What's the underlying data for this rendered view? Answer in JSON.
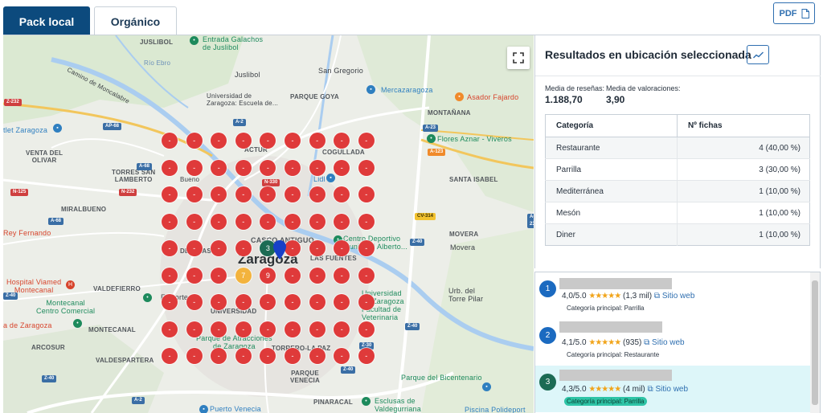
{
  "tabs": {
    "local": "Pack local",
    "organic": "Orgánico"
  },
  "pdf_button": "PDF",
  "map": {
    "city": "Zaragoza",
    "labels": {
      "juslibol": "JUSLIBOL",
      "galachos": "Entrada Galachos\nde Juslibol",
      "juslibol2": "Juslibol",
      "rio_ebro": "Río Ebro",
      "san_gregorio": "San Gregorio",
      "moncalabre": "Camino de Moncalabre",
      "universidad_empresa": "Universidad de\nZaragoza: Escuela de...",
      "parque_goya": "PARQUE GOYA",
      "mercazaragoza": "Mercazaragoza",
      "asador": "Asador Fajardo",
      "montanana": "MONTAÑANA",
      "outlet": "tlet Zaragoza",
      "venta_olivar": "VENTA DEL\nOLIVAR",
      "torres_san_lamberto": "TORRES SAN\nLAMBERTO",
      "actur": "ACTUR",
      "cogullada": "COGULLADA",
      "flores": "Flores Aznar - Viveros",
      "santa_isabel": "SANTA ISABEL",
      "bueno": "Bueno",
      "lidl": "Lidl",
      "miralbueno": "MIRALBUENO",
      "rey_fernando": "Rey Fernando",
      "casco_antiguo": "CASCO ANTIGUO",
      "centro_deportivo": "Centro Deportivo\nMunicipal Alberto...",
      "movera_caps": "MOVERA",
      "movera": "Movera",
      "delicias": "DELICIAS",
      "las_fuentes": "LAS FUENTES",
      "hospital": "Hospital Viamed\nMontecanal",
      "valdefierro": "VALDEFIERRO",
      "montecanal_c": "Montecanal\nCentro Comercial",
      "el_corte": "El Corte",
      "universidad": "UNIVERSIDAD",
      "univ_vet": "Universidad\nde Zaragoza\nFacultad de\nVeterinaria",
      "urb_torre": "Urb. del\nTorre Pilar",
      "la_de_zaragoza": "a de Zaragoza",
      "montecanal": "MONTECANAL",
      "parque_atracciones": "Parque de Atracciones\nde Zaragoza",
      "arcosur": "ARCOSUR",
      "valdespartera": "VALDESPARTERA",
      "torrero": "TORRERO-LA PAZ",
      "parque_venecia": "PARQUE\nVENECIA",
      "pinaracal": "PINARACAL",
      "bicentenario": "Parque del Bicentenario",
      "esclusas": "Esclusas de\nValdegurriana",
      "venecia": "Puerto Venecia",
      "piscina": "Piscina Polideport"
    },
    "road_tags": [
      "Z-232",
      "AP-68",
      "A-2",
      "A-23",
      "N-232",
      "N-125",
      "A-68",
      "N-330",
      "CV-314",
      "A-68",
      "Z-40",
      "Z-40",
      "A-23",
      "Z-30",
      "Z-40",
      "Z-40",
      "A-2",
      "Z-40",
      "A-123"
    ],
    "grid": {
      "rows": 9,
      "cols": 9,
      "cells": [
        [
          "-",
          "-",
          "-",
          "-",
          "-",
          "-",
          "-",
          "-",
          "-"
        ],
        [
          "-",
          "-",
          "-",
          "-",
          "-",
          "-",
          "-",
          "-",
          "-"
        ],
        [
          "-",
          "-",
          "-",
          "-",
          "-",
          "-",
          "-",
          "-",
          "-"
        ],
        [
          "-",
          "-",
          "-",
          "-",
          "-",
          "-",
          "-",
          "-",
          "-"
        ],
        [
          "-",
          "-",
          "-",
          "-",
          "3",
          "-",
          "-",
          "-",
          "-"
        ],
        [
          "-",
          "-",
          "-",
          "7",
          "9",
          "-",
          "-",
          "-",
          "-"
        ],
        [
          "-",
          "-",
          "-",
          "-",
          "-",
          "-",
          "-",
          "-",
          "-"
        ],
        [
          "-",
          "-",
          "-",
          "-",
          "-",
          "-",
          "-",
          "-",
          "-"
        ],
        [
          "-",
          "-",
          "-",
          "-",
          "-",
          "-",
          "-",
          "-",
          "-"
        ]
      ],
      "highlight_colors": {
        "3": "#1c6b54",
        "7": "#f3b33d"
      }
    }
  },
  "panel": {
    "title": "Resultados en ubicación seleccionada",
    "reviews_label": "Media de reseñas:",
    "reviews_value": "1.188,70",
    "ratings_label": "Media de valoraciones:",
    "ratings_value": "3,90",
    "table_headers": [
      "Categoría",
      "Nº fichas"
    ],
    "table_rows": [
      {
        "category": "Restaurante",
        "count": "4 (40,00 %)"
      },
      {
        "category": "Parrilla",
        "count": "3 (30,00 %)"
      },
      {
        "category": "Mediterránea",
        "count": "1 (10,00 %)"
      },
      {
        "category": "Mesón",
        "count": "1 (10,00 %)"
      },
      {
        "category": "Diner",
        "count": "1 (10,00 %)"
      }
    ]
  },
  "results": [
    {
      "rank": "1",
      "score": "4,0/5.0",
      "stars": "★★★★★",
      "count": "(1,3 mil)",
      "web": "Sitio web",
      "category": "Categoría principal: Parrilla",
      "rank_color": "#1b6ac0"
    },
    {
      "rank": "2",
      "score": "4,1/5.0",
      "stars": "★★★★★",
      "count": "(935)",
      "web": "Sitio web",
      "category": "Categoría principal: Restaurante",
      "rank_color": "#1b6ac0"
    },
    {
      "rank": "3",
      "score": "4,3/5.0",
      "stars": "★★★★★",
      "count": "(4 mil)",
      "web": "Sitio web",
      "category": "Categoría principal: Parrilla",
      "rank_color": "#1c6b54"
    }
  ]
}
